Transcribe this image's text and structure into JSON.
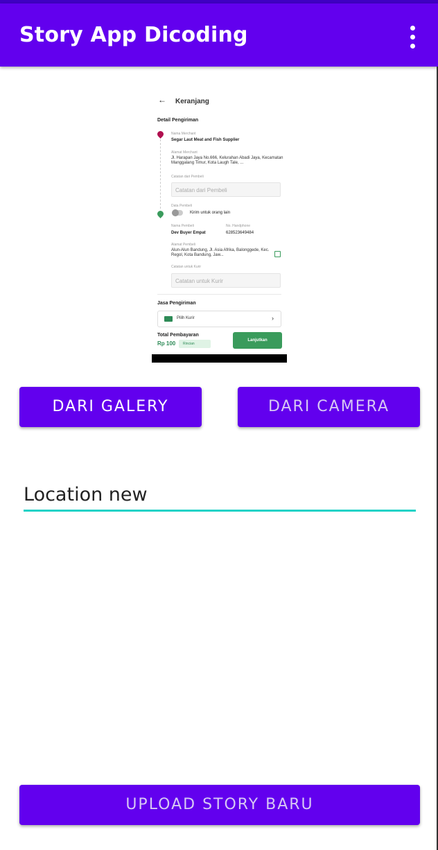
{
  "app_bar": {
    "title": "Story App Dicoding"
  },
  "preview": {
    "title": "Keranjang",
    "detail_header": "Detail Pengiriman",
    "merchant_label": "Nama Merchant",
    "merchant_name": "Segar Laut Meat and Fish Supplier",
    "merchant_address_label": "Alamat Merchant",
    "merchant_address": "Jl. Harapan Jaya No.666, Kelurahan Abadi Jaya, Kecamatan Manggalang Timur, Kota Laugh Tale, ...",
    "seller_note_label": "Catatan dari Pembeli",
    "seller_note_placeholder": "Catatan dari Pembeli",
    "buyer_data_label": "Data Pembeli",
    "send_other_label": "Kirim untuk orang lain",
    "buyer_name_label": "Nama Pembeli",
    "buyer_name": "Dev Buyer Empat",
    "phone_label": "No. Handphone",
    "phone": "628523649484",
    "buyer_address_label": "Alamat Pembeli",
    "buyer_address": "Alun-Alun Bandung, Jl. Asia Afrika, Balonggede, Kec. Regol, Kota Bandung, Jaw...",
    "courier_note_label": "Catatan untuk Kurir",
    "courier_note_placeholder": "Catatan untuk Kurir",
    "shipping_header": "Jasa Pengiriman",
    "choose_courier": "Pilih Kurir",
    "total_label": "Total Pembayaran",
    "total_price": "Rp 100",
    "details_button": "Rincian",
    "continue_button": "Lanjutkan"
  },
  "buttons": {
    "gallery": "DARI GALERY",
    "camera": "DARI CAMERA",
    "upload": "UPLOAD STORY BARU"
  },
  "location": {
    "value": "Location new"
  },
  "colors": {
    "primary": "#6200ee",
    "accent": "#1ed2c6",
    "preview_green": "#3a9b5c"
  },
  "icons": {
    "menu": "more-vert-icon",
    "back": "arrow-left-icon",
    "truck": "truck-icon"
  }
}
